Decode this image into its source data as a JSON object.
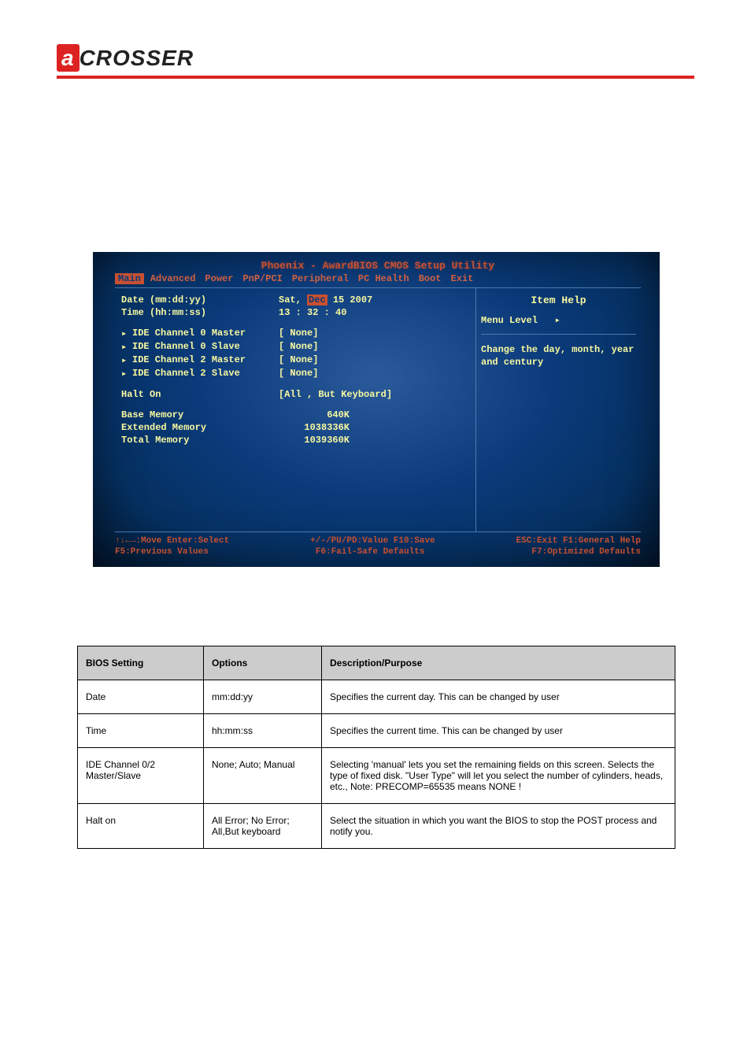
{
  "logo": {
    "a": "a",
    "rest": "CROSSER"
  },
  "bios": {
    "title": "Phoenix - AwardBIOS CMOS Setup Utility",
    "menu": [
      "Main",
      "Advanced",
      "Power",
      "PnP/PCI",
      "Peripheral",
      "PC Health",
      "Boot",
      "Exit"
    ],
    "active_menu": 0,
    "rows": {
      "date_label": "Date (mm:dd:yy)",
      "date_value_pre": "Sat, ",
      "date_value_hl": "Dec",
      "date_value_post": " 15 2007",
      "time_label": "Time (hh:mm:ss)",
      "time_value": "13 : 32 : 40",
      "ide0m": "IDE Channel 0 Master",
      "ide0s": "IDE Channel 0 Slave",
      "ide2m": "IDE Channel 2 Master",
      "ide2s": "IDE Channel 2 Slave",
      "ide_val": "[ None]",
      "halt_label": "Halt On",
      "halt_val": "[All , But Keyboard]",
      "base_label": "Base Memory",
      "base_val": "640K",
      "ext_label": "Extended Memory",
      "ext_val": "1038336K",
      "tot_label": "Total Memory",
      "tot_val": "1039360K"
    },
    "help": {
      "title": "Item Help",
      "level_label": "Menu Level",
      "text": "Change the day, month, year and century"
    },
    "footer": {
      "l1a": "↑↓←→:Move  Enter:Select",
      "l1b": "+/-/PU/PD:Value  F10:Save",
      "l1c": "ESC:Exit  F1:General Help",
      "l2a": "F5:Previous Values",
      "l2b": "F6:Fail-Safe Defaults",
      "l2c": "F7:Optimized Defaults"
    }
  },
  "table": {
    "headers": [
      "BIOS Setting",
      "Options",
      "Description/Purpose"
    ],
    "rows": [
      {
        "c0": "Date",
        "c1": "mm:dd:yy",
        "c2": "Specifies the current day. This can be changed by user"
      },
      {
        "c0": "Time",
        "c1": "hh:mm:ss",
        "c2": "Specifies the current time. This can be changed by user"
      },
      {
        "c0": "IDE Channel 0/2 Master/Slave",
        "c1": "None; Auto; Manual",
        "c2": "Selecting 'manual' lets you set the remaining fields on this screen. Selects the type of fixed disk. \"User Type\" will let you select the number of cylinders, heads, etc., Note: PRECOMP=65535 means NONE !"
      },
      {
        "c0": "Halt on",
        "c1": "All Error; No Error; All,But keyboard",
        "c2": "Select the situation in which you want the BIOS to stop the POST process and notify you."
      }
    ]
  }
}
